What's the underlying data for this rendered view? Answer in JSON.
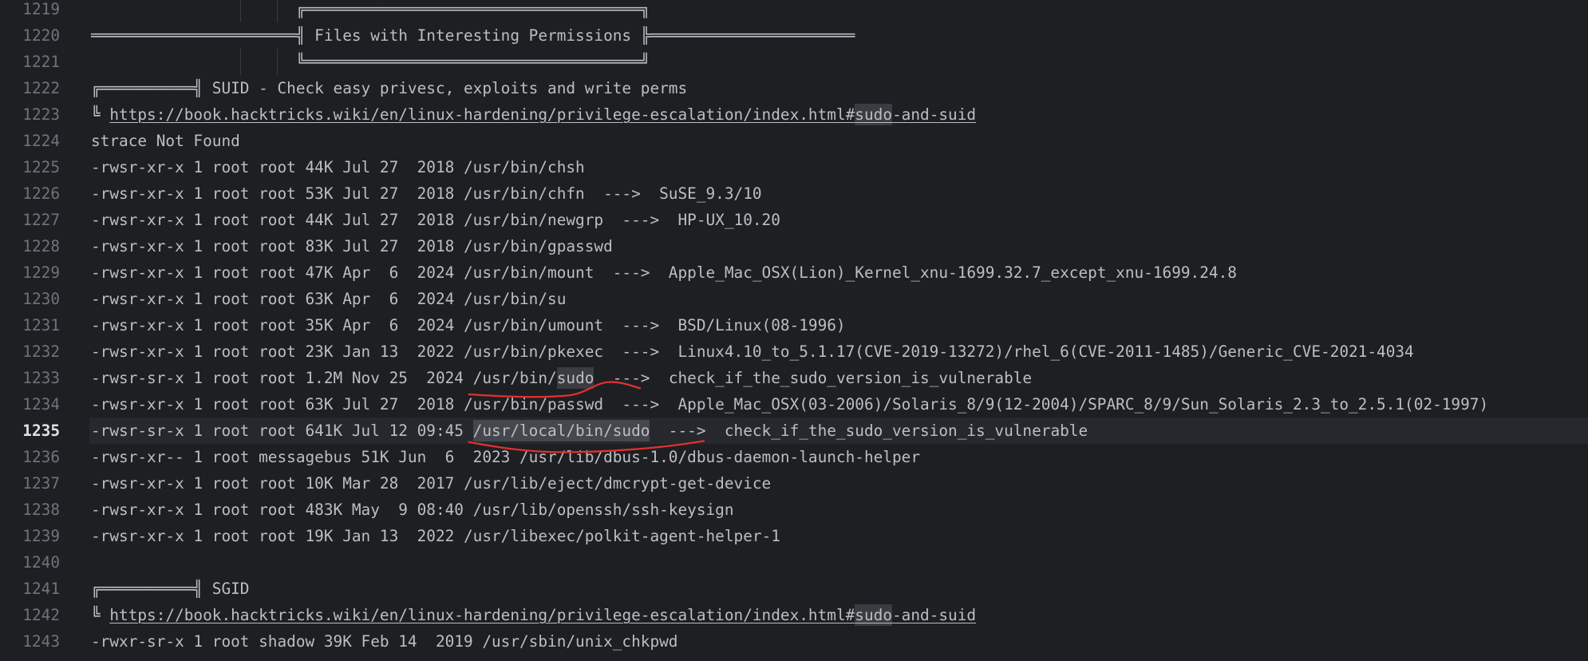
{
  "colors": {
    "background": "#1e1f22",
    "text": "#bcbec4",
    "line_number": "#6f737a",
    "current_line_number": "#dfe1e5",
    "current_line_bg": "#26282e",
    "match_bg": "#3a3c41",
    "selection_bg": "#44474d",
    "annotation": "#e0312f"
  },
  "editor": {
    "current_line": 1235,
    "lines": [
      {
        "n": 1219,
        "segs": [
          {
            "t": "                      ╔════════════════════════════════════╗"
          }
        ]
      },
      {
        "n": 1220,
        "segs": [
          {
            "t": "══════════════════════╣ Files with Interesting Permissions ╠══════════════════════"
          }
        ]
      },
      {
        "n": 1221,
        "segs": [
          {
            "t": "                      ╚════════════════════════════════════╝"
          }
        ]
      },
      {
        "n": 1222,
        "segs": [
          {
            "t": "╔══════════╣ SUID - Check easy privesc, exploits and write perms"
          }
        ]
      },
      {
        "n": 1223,
        "segs": [
          {
            "t": "╚ "
          },
          {
            "t": "https://book.hacktricks.wiki/en/linux-hardening/privilege-escalation/index.html#",
            "link": true
          },
          {
            "t": "sudo",
            "link": true,
            "match": true
          },
          {
            "t": "-and-suid",
            "link": true
          }
        ]
      },
      {
        "n": 1224,
        "segs": [
          {
            "t": "strace Not Found"
          }
        ]
      },
      {
        "n": 1225,
        "segs": [
          {
            "t": "-rwsr-xr-x 1 root root 44K Jul 27  2018 /usr/bin/chsh"
          }
        ]
      },
      {
        "n": 1226,
        "segs": [
          {
            "t": "-rwsr-xr-x 1 root root 53K Jul 27  2018 /usr/bin/chfn  --->  SuSE_9.3/10"
          }
        ]
      },
      {
        "n": 1227,
        "segs": [
          {
            "t": "-rwsr-xr-x 1 root root 44K Jul 27  2018 /usr/bin/newgrp  --->  HP-UX_10.20"
          }
        ]
      },
      {
        "n": 1228,
        "segs": [
          {
            "t": "-rwsr-xr-x 1 root root 83K Jul 27  2018 /usr/bin/gpasswd"
          }
        ]
      },
      {
        "n": 1229,
        "segs": [
          {
            "t": "-rwsr-xr-x 1 root root 47K Apr  6  2024 /usr/bin/mount  --->  Apple_Mac_OSX(Lion)_Kernel_xnu-1699.32.7_except_xnu-1699.24.8"
          }
        ]
      },
      {
        "n": 1230,
        "segs": [
          {
            "t": "-rwsr-xr-x 1 root root 63K Apr  6  2024 /usr/bin/su"
          }
        ]
      },
      {
        "n": 1231,
        "segs": [
          {
            "t": "-rwsr-xr-x 1 root root 35K Apr  6  2024 /usr/bin/umount  --->  BSD/Linux(08-1996)"
          }
        ]
      },
      {
        "n": 1232,
        "segs": [
          {
            "t": "-rwsr-xr-x 1 root root 23K Jan 13  2022 /usr/bin/pkexec  --->  Linux4.10_to_5.1.17(CVE-2019-13272)/rhel_6(CVE-2011-1485)/Generic_CVE-2021-4034"
          }
        ]
      },
      {
        "n": 1233,
        "segs": [
          {
            "t": "-rwsr-sr-x 1 root root 1.2M Nov 25  2024 /usr/bin/"
          },
          {
            "t": "sudo",
            "match": true
          },
          {
            "t": "  --->  check_if_the_sudo_version_is_vulnerable"
          }
        ]
      },
      {
        "n": 1234,
        "segs": [
          {
            "t": "-rwsr-xr-x 1 root root 63K Jul 27  2018 /usr/bin/passwd  --->  Apple_Mac_OSX(03-2006)/Solaris_8/9(12-2004)/SPARC_8/9/Sun_Solaris_2.3_to_2.5.1(02-1997)"
          }
        ]
      },
      {
        "n": 1235,
        "segs": [
          {
            "t": "-rwsr-sr-x 1 root root 641K Jul 12 09:45 "
          },
          {
            "t": "/usr/local/bin/sudo",
            "selected": true
          },
          {
            "t": "  --->  check_if_the_sudo_version_is_vulnerable"
          }
        ]
      },
      {
        "n": 1236,
        "segs": [
          {
            "t": "-rwsr-xr-- 1 root messagebus 51K Jun  6  2023 /usr/lib/dbus-1.0/dbus-daemon-launch-helper"
          }
        ]
      },
      {
        "n": 1237,
        "segs": [
          {
            "t": "-rwsr-xr-x 1 root root 10K Mar 28  2017 /usr/lib/eject/dmcrypt-get-device"
          }
        ]
      },
      {
        "n": 1238,
        "segs": [
          {
            "t": "-rwsr-xr-x 1 root root 483K May  9 08:40 /usr/lib/openssh/ssh-keysign"
          }
        ]
      },
      {
        "n": 1239,
        "segs": [
          {
            "t": "-rwsr-xr-x 1 root root 19K Jan 13  2022 /usr/libexec/polkit-agent-helper-1"
          }
        ]
      },
      {
        "n": 1240,
        "segs": []
      },
      {
        "n": 1241,
        "segs": [
          {
            "t": "╔══════════╣ SGID"
          }
        ]
      },
      {
        "n": 1242,
        "segs": [
          {
            "t": "╚ "
          },
          {
            "t": "https://book.hacktricks.wiki/en/linux-hardening/privilege-escalation/index.html#",
            "link": true
          },
          {
            "t": "sudo",
            "link": true,
            "match": true
          },
          {
            "t": "-and-suid",
            "link": true
          }
        ]
      },
      {
        "n": 1243,
        "segs": [
          {
            "t": "-rwxr-sr-x 1 root shadow 39K Feb 14  2019 /usr/sbin/unix_chkpwd"
          }
        ]
      }
    ]
  }
}
